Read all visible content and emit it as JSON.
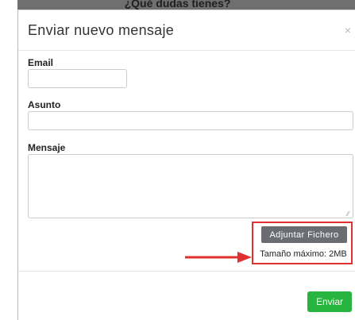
{
  "background": {
    "title": "¿Qué dudas tienes?"
  },
  "modal": {
    "title": "Enviar nuevo mensaje",
    "close_glyph": "×",
    "fields": {
      "email_label": "Email",
      "email_value": "",
      "subject_label": "Asunto",
      "subject_value": "",
      "message_label": "Mensaje",
      "message_value": ""
    },
    "attach_label": "Adjuntar Fichero",
    "max_size_note": "Tamaño máximo: 2MB",
    "send_label": "Enviar"
  },
  "colors": {
    "send_button": "#27b43f",
    "attach_button": "#6a6e72",
    "annotation": "#e23030"
  },
  "icons": {
    "close": "close-icon",
    "annotation_arrow": "arrow-right-icon"
  }
}
